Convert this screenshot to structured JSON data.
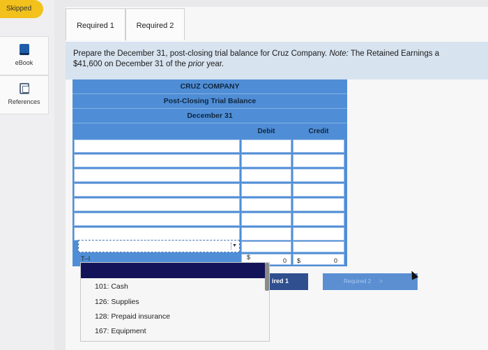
{
  "status": {
    "skipped": "Skipped"
  },
  "rail": {
    "ebook": "eBook",
    "references": "References"
  },
  "tabs": [
    {
      "label": "Required 1"
    },
    {
      "label": "Required 2"
    }
  ],
  "prompt": {
    "line1_prefix": "Prepare the December 31, post-closing trial balance for Cruz Company.",
    "note_label": "Note:",
    "line1_suffix": "The Retained Earnings a",
    "line2_prefix": "$41,600 on December 31 of the",
    "line2_italic": "prior",
    "line2_suffix": "year."
  },
  "trial_balance": {
    "company": "CRUZ COMPANY",
    "title": "Post-Closing Trial Balance",
    "date": "December 31",
    "columns": {
      "debit": "Debit",
      "credit": "Credit"
    },
    "totals": {
      "label_partial": "T--l",
      "debit_currency": "$",
      "debit": "0",
      "credit_currency": "$",
      "credit": "0"
    }
  },
  "dropdown": {
    "options": [
      "101: Cash",
      "126: Supplies",
      "128: Prepaid insurance",
      "167: Equipment"
    ]
  },
  "nav": {
    "prev": "ired 1",
    "next": "Required 2",
    "next_chevron": ">"
  }
}
